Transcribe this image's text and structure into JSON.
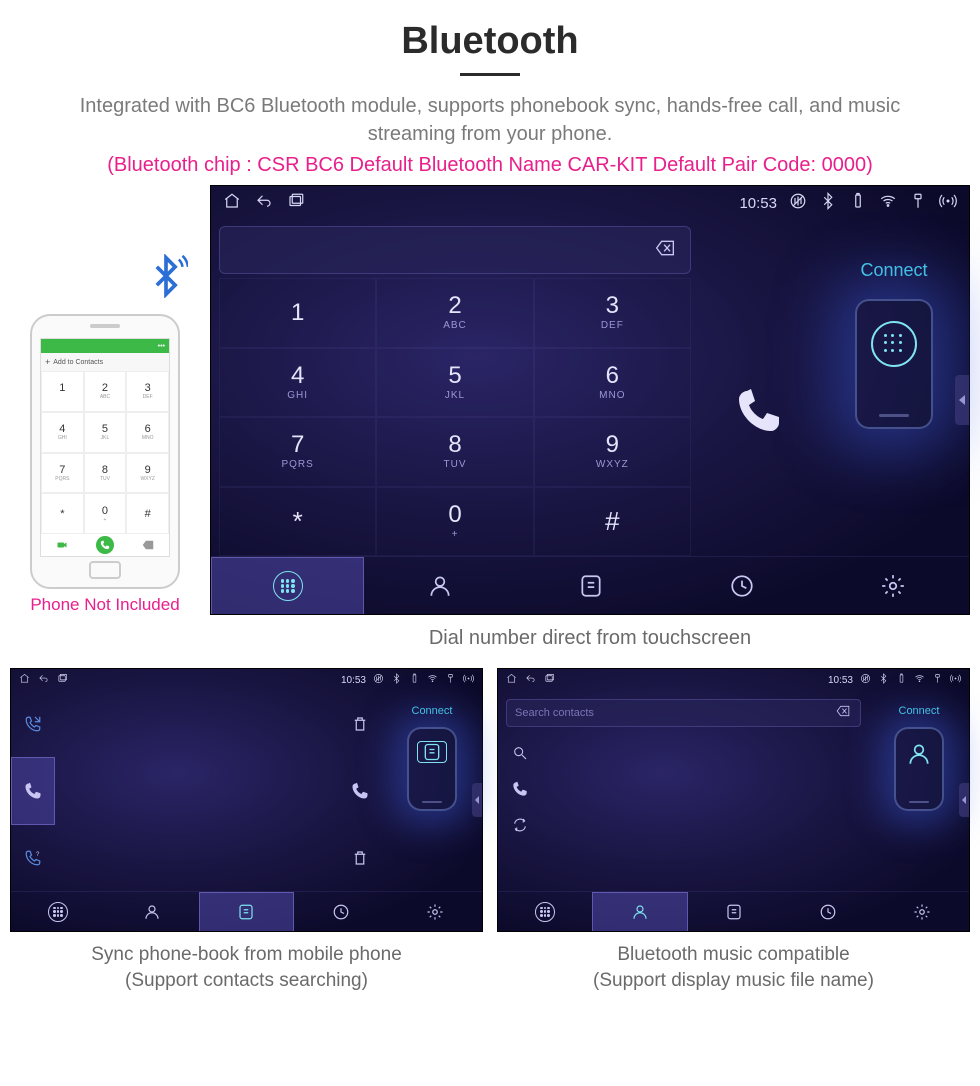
{
  "header": {
    "title": "Bluetooth",
    "desc": "Integrated with BC6 Bluetooth module, supports phonebook sync, hands-free call, and music streaming from your phone.",
    "spec": "(Bluetooth chip : CSR BC6     Default Bluetooth Name CAR-KIT     Default Pair Code: 0000)"
  },
  "phone": {
    "note": "Phone Not Included",
    "add_contacts": "Add to Contacts"
  },
  "statusbar": {
    "time": "10:53"
  },
  "connect": {
    "label": "Connect"
  },
  "keypad": [
    {
      "num": "1",
      "sub": ""
    },
    {
      "num": "2",
      "sub": "ABC"
    },
    {
      "num": "3",
      "sub": "DEF"
    },
    {
      "num": "4",
      "sub": "GHI"
    },
    {
      "num": "5",
      "sub": "JKL"
    },
    {
      "num": "6",
      "sub": "MNO"
    },
    {
      "num": "7",
      "sub": "PQRS"
    },
    {
      "num": "8",
      "sub": "TUV"
    },
    {
      "num": "9",
      "sub": "WXYZ"
    },
    {
      "num": "*",
      "sub": ""
    },
    {
      "num": "0",
      "sub": "+"
    },
    {
      "num": "#",
      "sub": ""
    }
  ],
  "captions": {
    "main": "Dial number direct from touchscreen",
    "left_a": "Sync phone-book from mobile phone",
    "left_b": "(Support contacts searching)",
    "right_a": "Bluetooth music compatible",
    "right_b": "(Support display music file name)"
  },
  "search": {
    "placeholder": "Search contacts"
  }
}
